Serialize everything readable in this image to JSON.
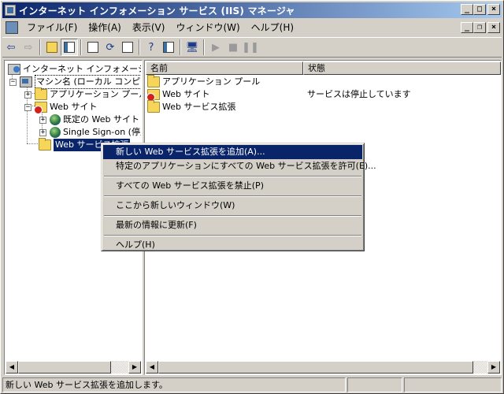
{
  "window": {
    "title": "インターネット インフォメーション サービス (IIS) マネージャ"
  },
  "title_buttons": {
    "minimize": "_",
    "maximize": "□",
    "close": "×"
  },
  "menu": [
    "ファイル(F)",
    "操作(A)",
    "表示(V)",
    "ウィンドウ(W)",
    "ヘルプ(H)"
  ],
  "mdi_buttons": {
    "minimize": "_",
    "restore": "❐",
    "close": "×"
  },
  "toolbar": [
    "back",
    "forward",
    "up-folder",
    "show-hide-tree",
    "properties",
    "refresh",
    "export-list",
    "help",
    "show-hide-action-pane",
    "computer",
    "start",
    "stop",
    "pause"
  ],
  "tree": {
    "root": "インターネット インフォメーション サービス",
    "machine": "マシン名 (ローカル コンピュータ)",
    "app_pools": "アプリケーション プール",
    "web_sites": "Web サイト",
    "default_site": "既定の Web サイト",
    "sso_site": "Single Sign-on (停止)",
    "web_ext": "Web サービス拡張"
  },
  "list": {
    "columns": [
      "名前",
      "状態"
    ],
    "rows": [
      {
        "name": "アプリケーション プール",
        "status": "",
        "icon": "folder-icon"
      },
      {
        "name": "Web サイト",
        "status": "サービスは停止しています",
        "icon": "stopped-web-folder-icon"
      },
      {
        "name": "Web サービス拡張",
        "status": "",
        "icon": "folder-icon"
      }
    ]
  },
  "context_menu": {
    "add_new": "新しい Web サービス拡張を追加(A)...",
    "allow_all": "特定のアプリケーションにすべての Web サービス拡張を許可(E)...",
    "prohibit_all": "すべての Web サービス拡張を禁止(P)",
    "new_window": "ここから新しいウィンドウ(W)",
    "refresh": "最新の情報に更新(F)",
    "help": "ヘルプ(H)"
  },
  "statusbar": {
    "text": "新しい Web サービス拡張を追加します。"
  },
  "colors": {
    "title_start": "#0a246a",
    "title_end": "#a6caf0",
    "selection": "#0a246a",
    "chrome": "#d4d0c8"
  }
}
